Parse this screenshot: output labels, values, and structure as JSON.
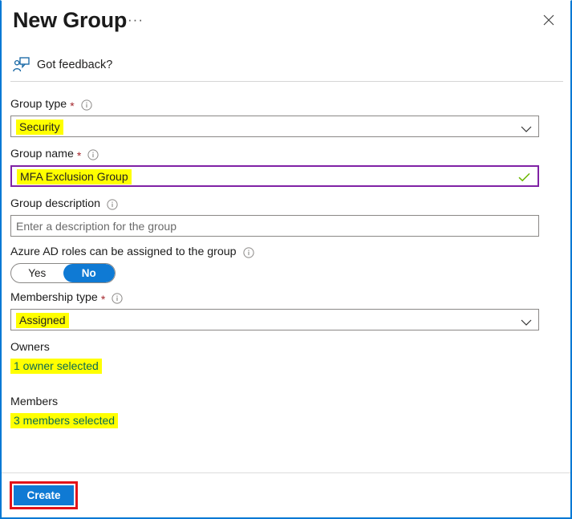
{
  "window": {
    "title": "New Group",
    "ellipsis_label": "···",
    "close_label": "Close"
  },
  "feedback": {
    "label": "Got feedback?"
  },
  "form": {
    "group_type": {
      "label": "Group type",
      "required_marker": "*",
      "value": "Security"
    },
    "group_name": {
      "label": "Group name",
      "required_marker": "*",
      "value": "MFA Exclusion Group"
    },
    "group_description": {
      "label": "Group description",
      "placeholder": "Enter a description for the group",
      "value": ""
    },
    "azure_ad_roles": {
      "label": "Azure AD roles can be assigned to the group",
      "option_yes": "Yes",
      "option_no": "No",
      "selected": "No"
    },
    "membership_type": {
      "label": "Membership type",
      "required_marker": "*",
      "value": "Assigned"
    },
    "owners": {
      "label": "Owners",
      "value": "1 owner selected"
    },
    "members": {
      "label": "Members",
      "value": "3 members selected"
    }
  },
  "footer": {
    "create_label": "Create"
  },
  "colors": {
    "accent_blue": "#0078d4",
    "button_blue": "#0f7ad4",
    "annotation_red": "#e31219",
    "highlight_yellow": "#ffff00",
    "focus_purple": "#8022a5",
    "required_red": "#a4262c",
    "success_green": "#6bb700",
    "link_green": "#0b6a53"
  },
  "icons": {
    "close": "close-icon",
    "ellipsis": "ellipsis-icon",
    "feedback": "feedback-person-icon",
    "info": "info-icon",
    "chevron": "chevron-down-icon",
    "valid": "checkmark-icon"
  }
}
